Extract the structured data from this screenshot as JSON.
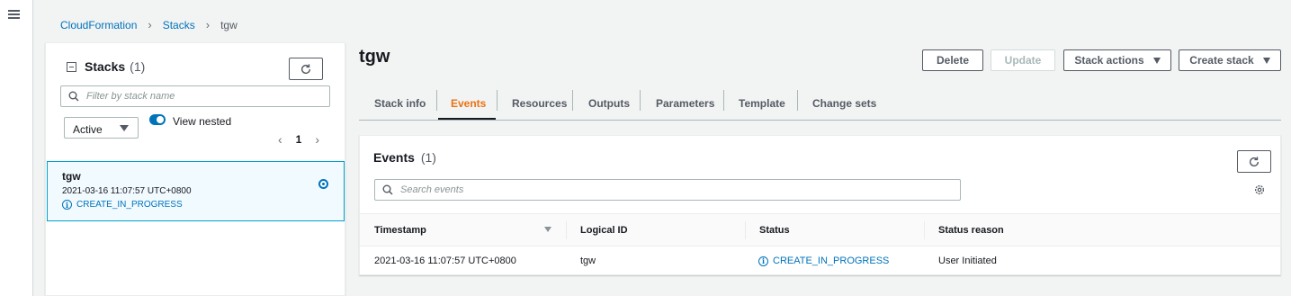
{
  "breadcrumb": {
    "root": "CloudFormation",
    "section": "Stacks",
    "current": "tgw"
  },
  "left_panel": {
    "title": "Stacks",
    "count": "(1)",
    "search_placeholder": "Filter by stack name",
    "filter_value": "Active",
    "toggle_label": "View nested",
    "toggle_on": true,
    "page": "1",
    "stacks": [
      {
        "name": "tgw",
        "timestamp": "2021-03-16 11:07:57 UTC+0800",
        "status": "CREATE_IN_PROGRESS",
        "selected": true
      }
    ]
  },
  "page_title": "tgw",
  "actions": {
    "delete": "Delete",
    "update": "Update",
    "stack_actions": "Stack actions",
    "create_stack": "Create stack"
  },
  "tabs": [
    {
      "label": "Stack info",
      "active": false
    },
    {
      "label": "Events",
      "active": true
    },
    {
      "label": "Resources",
      "active": false
    },
    {
      "label": "Outputs",
      "active": false
    },
    {
      "label": "Parameters",
      "active": false
    },
    {
      "label": "Template",
      "active": false
    },
    {
      "label": "Change sets",
      "active": false
    }
  ],
  "events": {
    "title": "Events",
    "count": "(1)",
    "search_placeholder": "Search events",
    "columns": [
      "Timestamp",
      "Logical ID",
      "Status",
      "Status reason"
    ],
    "rows": [
      {
        "timestamp": "2021-03-16 11:07:57 UTC+0800",
        "logical_id": "tgw",
        "status": "CREATE_IN_PROGRESS",
        "reason": "User Initiated"
      }
    ]
  },
  "colors": {
    "link": "#0073bb",
    "active_tab": "#ec7211",
    "selected_bg": "#f1faff"
  }
}
